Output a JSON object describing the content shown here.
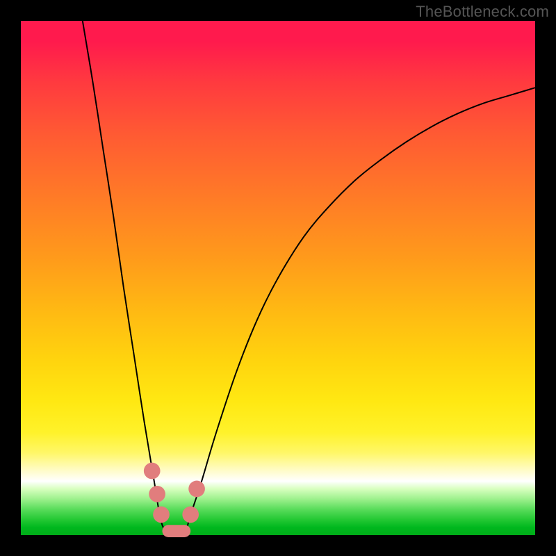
{
  "watermark": "TheBottleneck.com",
  "colors": {
    "background": "#000000",
    "curve": "#000000",
    "marker": "#e17d7d"
  },
  "chart_data": {
    "type": "line",
    "title": "",
    "xlabel": "",
    "ylabel": "",
    "xlim": [
      0,
      100
    ],
    "ylim": [
      0,
      100
    ],
    "grid": false,
    "legend": false,
    "note": "V-shaped bottleneck curve; values estimated from pixel positions on a 0–100 scale (0 = bottom/left). Minimum ~0 around x≈27–32.",
    "series": [
      {
        "name": "bottleneck",
        "x": [
          12,
          14,
          16,
          18,
          20,
          22,
          24,
          26,
          27,
          28,
          30,
          32,
          33,
          35,
          38,
          42,
          46,
          50,
          55,
          60,
          65,
          70,
          75,
          80,
          85,
          90,
          95,
          100
        ],
        "values": [
          100,
          88,
          75,
          62,
          48,
          35,
          22,
          10,
          4,
          1,
          0,
          1,
          4,
          10,
          20,
          32,
          42,
          50,
          58,
          64,
          69,
          73,
          76.5,
          79.5,
          82,
          84,
          85.5,
          87
        ]
      }
    ],
    "markers": {
      "note": "Salmon rounded segments near the curve minimum; coordinates on the same 0–100 scale.",
      "points": [
        {
          "x": 25.5,
          "y": 12.5,
          "r": 1.6
        },
        {
          "x": 26.5,
          "y": 8.0,
          "r": 1.6
        },
        {
          "x": 27.3,
          "y": 4.0,
          "r": 1.6
        },
        {
          "x": 33.0,
          "y": 4.0,
          "r": 1.6
        },
        {
          "x": 34.2,
          "y": 9.0,
          "r": 1.6
        }
      ],
      "floor_segment": {
        "x0": 27.5,
        "x1": 33.0,
        "y": 0.8,
        "thickness": 2.4
      }
    }
  }
}
